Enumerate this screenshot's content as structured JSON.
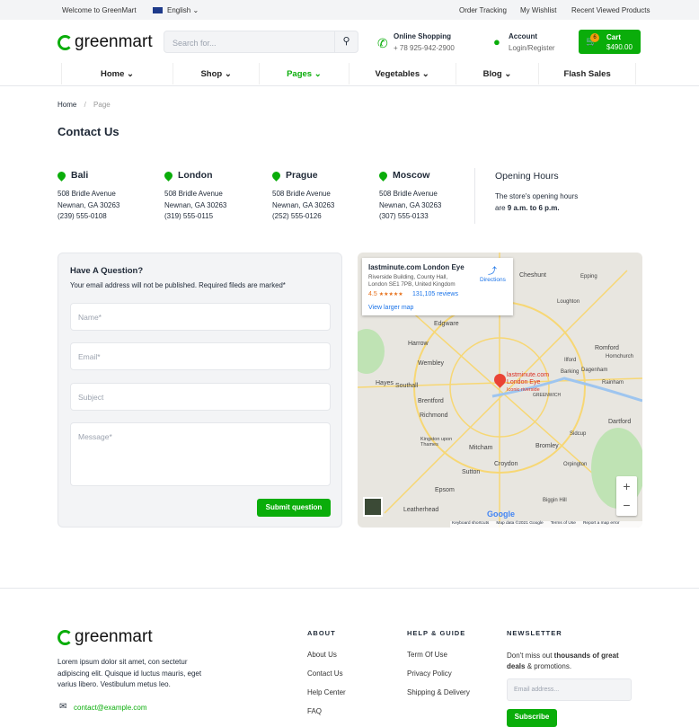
{
  "topbar": {
    "welcome": "Welcome to GreenMart",
    "language": "English",
    "links": [
      "Order Tracking",
      "My Wishlist",
      "Recent Viewed Products"
    ]
  },
  "header": {
    "logo": "greenmart",
    "search_placeholder": "Search for...",
    "phone_title": "Online Shopping",
    "phone": "+ 78 925-942-2900",
    "account_title": "Account",
    "account_sub": "Login/Register",
    "cart_label": "Cart",
    "cart_total": "$490.00",
    "cart_count": "6"
  },
  "nav": [
    "Home",
    "Shop",
    "Pages",
    "Vegetables",
    "Blog",
    "Flash Sales"
  ],
  "breadcrumb": {
    "home": "Home",
    "sep": "/",
    "current": "Page"
  },
  "page_title": "Contact Us",
  "locations": [
    {
      "city": "Bali",
      "street": "508 Bridle Avenue",
      "city_line": "Newnan, GA 30263",
      "phone": "(239) 555-0108"
    },
    {
      "city": "London",
      "street": "508 Bridle Avenue",
      "city_line": "Newnan, GA 30263",
      "phone": "(319) 555-0115"
    },
    {
      "city": "Prague",
      "street": "508 Bridle Avenue",
      "city_line": "Newnan, GA 30263",
      "phone": "(252) 555-0126"
    },
    {
      "city": "Moscow",
      "street": "508 Bridle Avenue",
      "city_line": "Newnan, GA 30263",
      "phone": "(307) 555-0133"
    }
  ],
  "hours": {
    "title": "Opening Hours",
    "text1": "The store's opening hours",
    "text2a": "are ",
    "text2b": "9 a.m. to 6 p.m."
  },
  "form": {
    "title": "Have A Question?",
    "note": "Your email address will not be published. Required fileds are marked*",
    "name": "Name*",
    "email": "Email*",
    "subject": "Subject",
    "message": "Message*",
    "submit": "Submit question"
  },
  "map": {
    "place": "lastminute.com London Eye",
    "address1": "Riverside Building, County Hall,",
    "address2": "London SE1 7PB, United Kingdom",
    "rating": "4.5",
    "stars": "★★★★★",
    "reviews": "131,105 reviews",
    "directions": "Directions",
    "larger": "View larger map",
    "pin_label1": "lastminute.com",
    "pin_label2": "London Eye",
    "pin_label3": "Iconic riverside",
    "places": [
      "Cheshunt",
      "Edgware",
      "Harrow",
      "Wembley",
      "Hayes",
      "Southall",
      "Brentford",
      "Richmond",
      "Romford",
      "Hornchurch",
      "Ilford",
      "Barking",
      "Dagenham",
      "GREENWICH",
      "Rainham",
      "Dartford",
      "Sidcup",
      "Bromley",
      "Mitcham",
      "Croydon",
      "Orpington",
      "Sutton",
      "Epsom",
      "Leatherhead",
      "Kingston upon Thames",
      "Biggin Hill",
      "Loughton",
      "Epping"
    ],
    "google": "Google",
    "footer_links": [
      "Keyboard shortcuts",
      "Map data ©2021 Google",
      "Terms of Use",
      "Report a map error"
    ],
    "zoom_in": "+",
    "zoom_out": "−"
  },
  "footer": {
    "logo": "greenmart",
    "about_text": "Lorem ipsum dolor sit amet, con sectetur adipiscing elit. Quisque id luctus mauris, eget varius libero. Vestibulum metus leo.",
    "email": "contact@example.com",
    "about_title": "ABOUT",
    "about_links": [
      "About Us",
      "Contact Us",
      "Help Center",
      "FAQ"
    ],
    "help_title": "HELP & GUIDE",
    "help_links": [
      "Term Of Use",
      "Privacy Policy",
      "Shipping & Delivery"
    ],
    "news_title": "NEWSLETTER",
    "news_a": "Don't miss out ",
    "news_b": "thousands of great deals",
    "news_c": " & promotions.",
    "email_placeholder": "Email address...",
    "subscribe": "Subscribe"
  },
  "colors": {
    "accent": "#0aad0a",
    "rating": "#e7711b",
    "link": "#1a73e8"
  }
}
